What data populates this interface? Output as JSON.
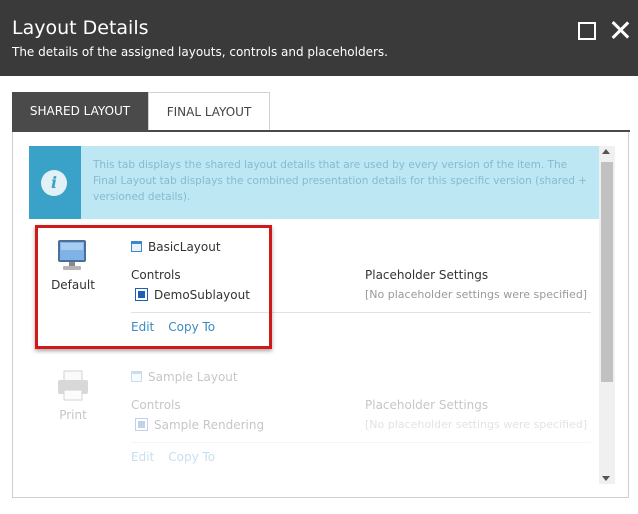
{
  "dialog": {
    "title": "Layout Details",
    "subtitle": "The details of the assigned layouts, controls and placeholders."
  },
  "tabs": [
    {
      "label": "SHARED LAYOUT",
      "active": true
    },
    {
      "label": "FINAL LAYOUT",
      "active": false
    }
  ],
  "info": {
    "text": "This tab displays the shared layout details that are used by every version of the item. The Final Layout tab displays the combined presentation details for this specific version (shared + versioned details)."
  },
  "devices": [
    {
      "name": "Default",
      "icon": "monitor-icon",
      "layout": "BasicLayout",
      "controls_label": "Controls",
      "controls": [
        "DemoSublayout"
      ],
      "placeholder_label": "Placeholder Settings",
      "placeholder_value": "[No placeholder settings were specified]",
      "edit_label": "Edit",
      "copy_label": "Copy To"
    },
    {
      "name": "Print",
      "icon": "printer-icon",
      "layout": "Sample Layout",
      "controls_label": "Controls",
      "controls": [
        "Sample Rendering"
      ],
      "placeholder_label": "Placeholder Settings",
      "placeholder_value": "[No placeholder settings were specified]",
      "edit_label": "Edit",
      "copy_label": "Copy To"
    }
  ],
  "colors": {
    "titlebar": "#3a3a3a",
    "active_tab": "#4a4a4a",
    "info_bg": "#bde7f3",
    "info_icon_bg": "#3aa2c9",
    "link": "#3b8bc2",
    "highlight": "#d01a1a"
  }
}
